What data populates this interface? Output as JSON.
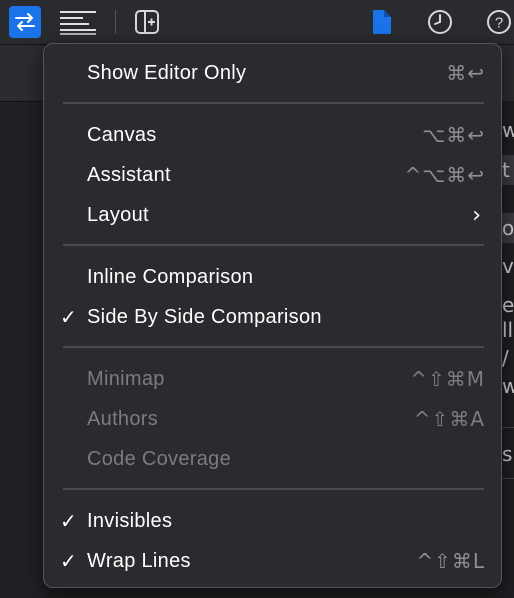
{
  "toolbar": {
    "icons": [
      "compare-arrows-icon",
      "lines-icon",
      "split-editor-icon",
      "document-icon",
      "history-icon",
      "help-icon"
    ],
    "help_glyph": "?",
    "accent": "#1a73e8"
  },
  "menu": {
    "show_editor_only": {
      "label": "Show Editor Only",
      "shortcut": "⌘↩"
    },
    "canvas": {
      "label": "Canvas",
      "shortcut": "⌥⌘↩"
    },
    "assistant": {
      "label": "Assistant",
      "shortcut": "^⌥⌘↩"
    },
    "layout": {
      "label": "Layout",
      "chevron": "›"
    },
    "inline_comparison": {
      "label": "Inline Comparison"
    },
    "side_by_side": {
      "label": "Side By Side Comparison",
      "check": "✓",
      "checked": true
    },
    "minimap": {
      "label": "Minimap",
      "shortcut": "^⇧⌘M",
      "disabled": true
    },
    "authors": {
      "label": "Authors",
      "shortcut": "^⇧⌘A",
      "disabled": true
    },
    "code_coverage": {
      "label": "Code Coverage",
      "disabled": true
    },
    "invisibles": {
      "label": "Invisibles",
      "check": "✓",
      "checked": true
    },
    "wrap_lines": {
      "label": "Wrap Lines",
      "check": "✓",
      "checked": true,
      "shortcut": "^⇧⌘L"
    }
  },
  "right_edge": {
    "chars": [
      "w",
      "t",
      "o",
      "v",
      "e",
      "ll",
      "/",
      "w",
      "s"
    ]
  }
}
